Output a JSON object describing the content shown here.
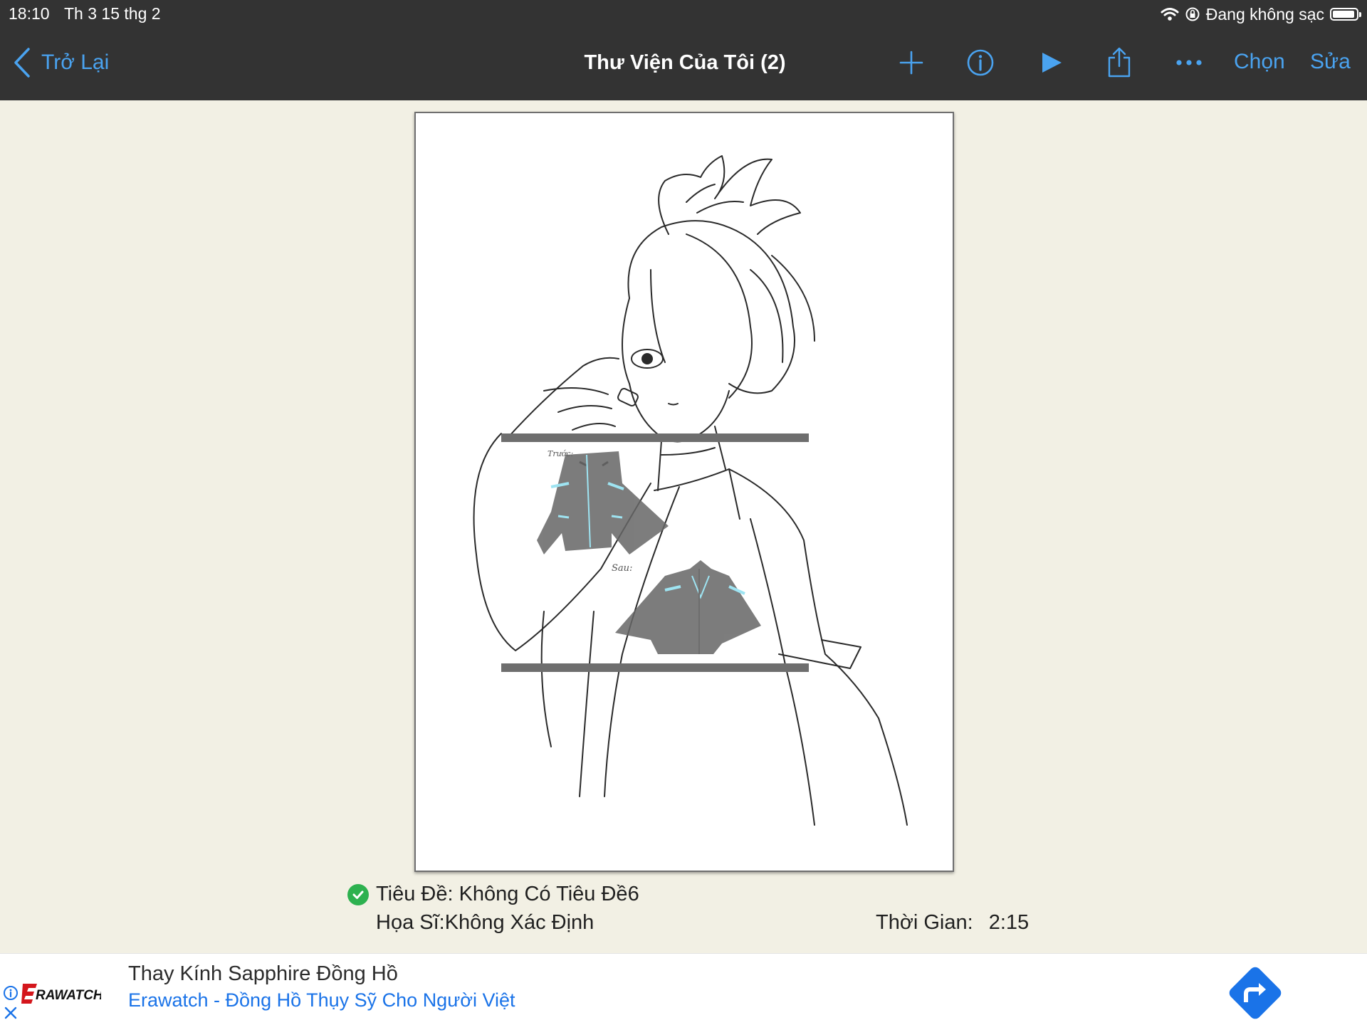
{
  "status_bar": {
    "time": "18:10",
    "date": "Th 3 15 thg 2",
    "charging_status": "Đang không sạc",
    "icons": [
      "wifi-icon",
      "orientation-lock-icon",
      "battery-icon"
    ]
  },
  "nav": {
    "back_label": "Trở Lại",
    "title": "Thư Viện Của Tôi (2)",
    "icons": [
      "add-icon",
      "info-icon",
      "play-icon",
      "share-icon",
      "more-icon"
    ],
    "select_label": "Chọn",
    "edit_label": "Sửa",
    "accent_color": "#4aa3f0",
    "bar_color": "#333333"
  },
  "artwork": {
    "inset_label_1": "Trước:",
    "inset_label_2": "Sau:"
  },
  "info": {
    "title_line": "Tiêu Đề: Không Có Tiêu Đề6",
    "artist_line": "Họa Sĩ:Không Xác Định",
    "time_label": "Thời Gian:",
    "time_value": "2:15",
    "status_color": "#2db14f"
  },
  "ad": {
    "brand_logo_text": "ERAWATCH",
    "headline": "Thay Kính Sapphire Đồng Hồ",
    "subline": "Erawatch - Đồng Hồ Thụy Sỹ Cho Người Việt",
    "cta_color": "#1a73e8"
  }
}
